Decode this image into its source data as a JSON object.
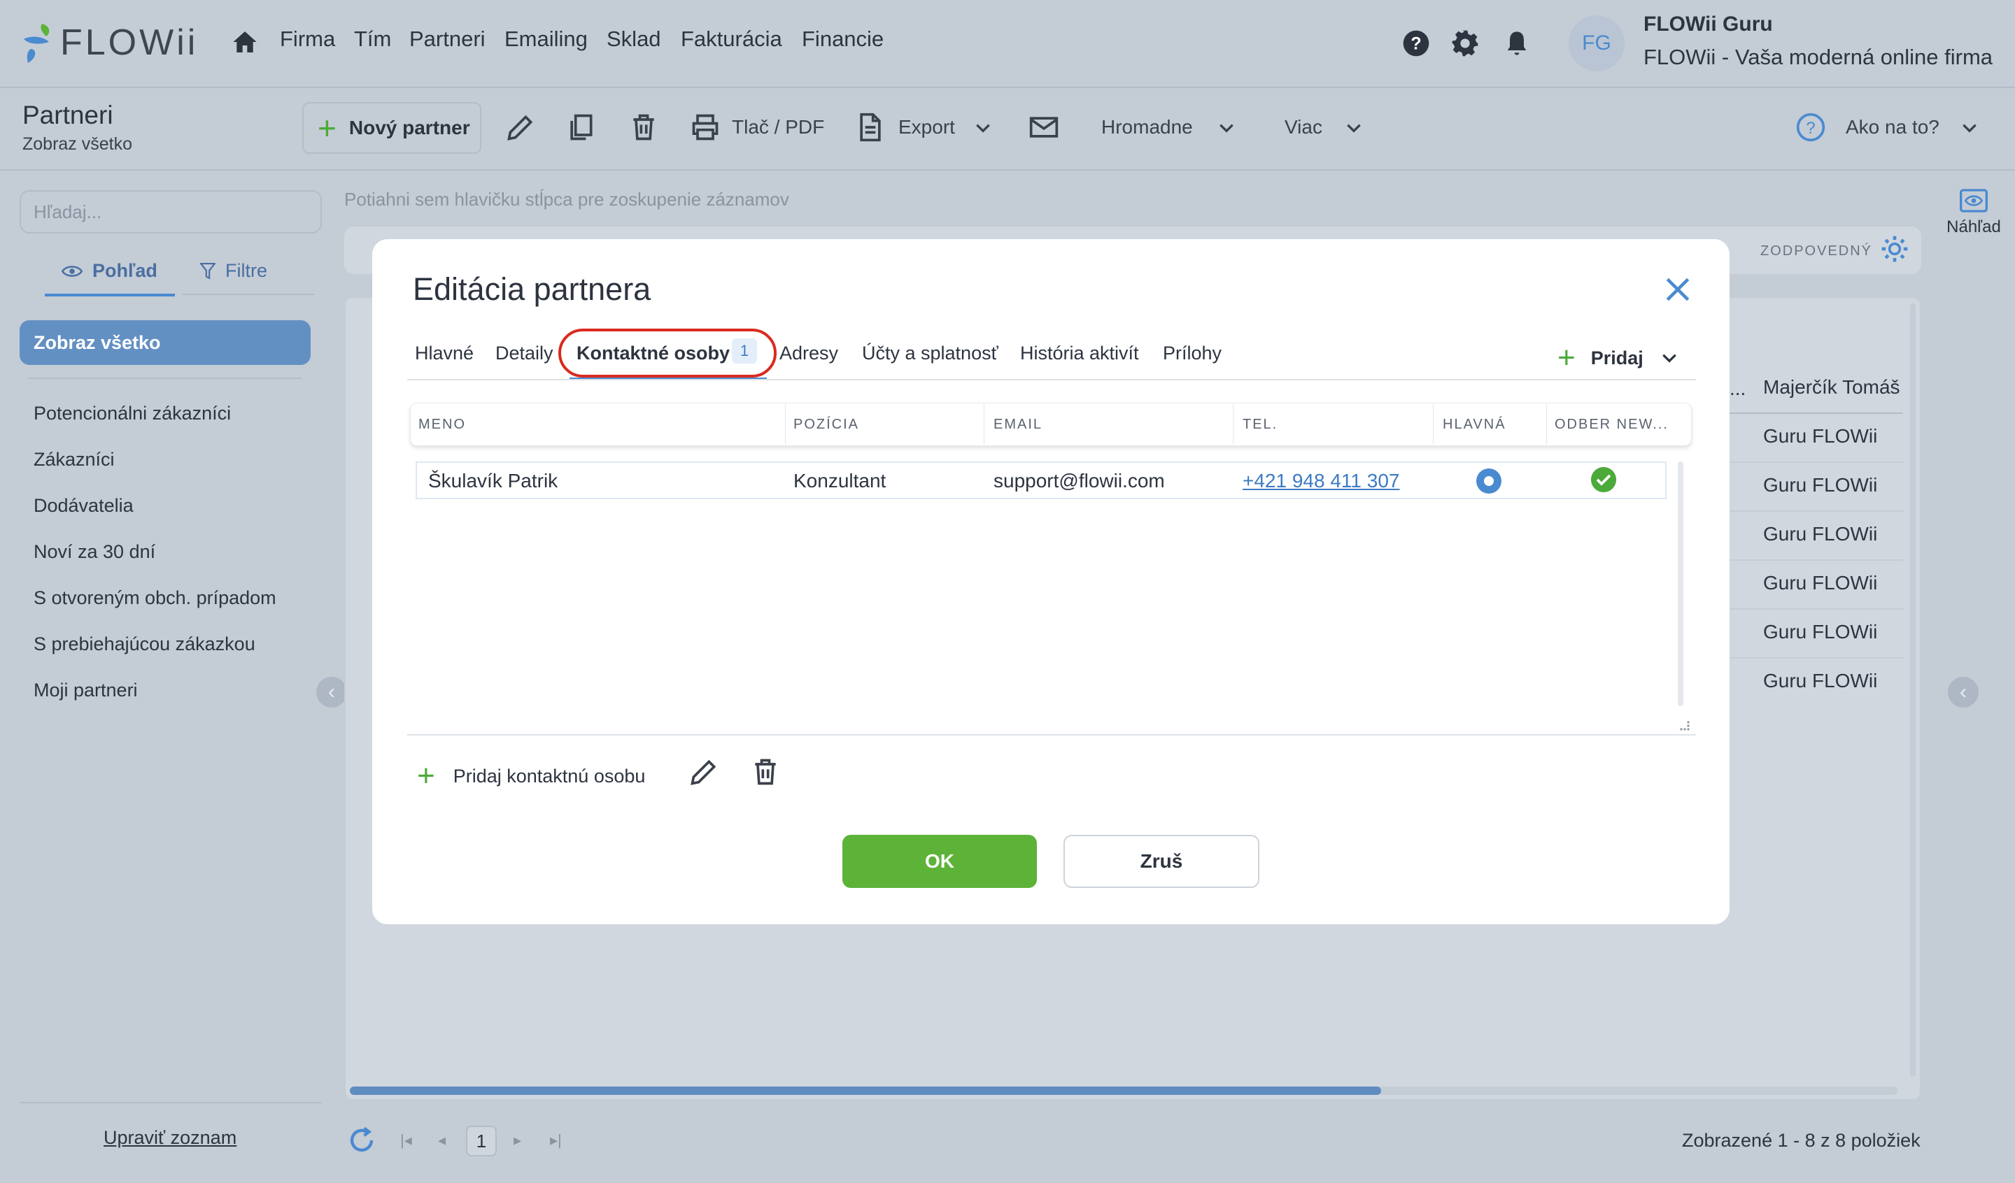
{
  "app": {
    "logo_text": "FLOWii"
  },
  "nav": {
    "items": [
      "Firma",
      "Tím",
      "Partneri",
      "Emailing",
      "Sklad",
      "Fakturácia",
      "Financie"
    ]
  },
  "user": {
    "initials": "FG",
    "name": "FLOWii Guru",
    "company": "FLOWii - Vaša moderná online firma"
  },
  "toolbar": {
    "title": "Partneri",
    "subtitle": "Zobraz všetko",
    "new_partner": "Nový partner",
    "print": "Tlač / PDF",
    "export": "Export",
    "bulk": "Hromadne",
    "more": "Viac",
    "help": "Ako na to?"
  },
  "sidebar": {
    "search_placeholder": "Hľadaj...",
    "tab_view": "Pohľad",
    "tab_filter": "Filtre",
    "active_item": "Zobraz všetko",
    "items": [
      "Potencionálni zákazníci",
      "Zákazníci",
      "Dodávatelia",
      "Noví za 30 dní",
      "S otvoreným obch. prípadom",
      "S prebiehajúcou zákazkou",
      "Moji partneri"
    ],
    "edit_list": "Upraviť zoznam"
  },
  "main": {
    "group_hint": "Potiahni sem hlavičku stĺpca pre zoskupenie záznamov",
    "responsible_label": "ZODPOVEDNÝ",
    "preview_label": "Náhľad",
    "col_ellipsis": "...",
    "visible_rows": [
      "Majerčík Tomáš",
      "Guru FLOWii",
      "Guru FLOWii",
      "Guru FLOWii",
      "Guru FLOWii",
      "Guru FLOWii",
      "Guru FLOWii"
    ]
  },
  "pager": {
    "page": "1",
    "info": "Zobrazené 1 - 8 z 8 položiek"
  },
  "modal": {
    "title": "Editácia partnera",
    "tabs": [
      "Hlavné",
      "Detaily",
      "Kontaktné osoby",
      "Adresy",
      "Účty a splatnosť",
      "História aktivít",
      "Prílohy"
    ],
    "active_tab_badge": "1",
    "add_label": "Pridaj",
    "columns": [
      "MENO",
      "POZÍCIA",
      "EMAIL",
      "TEL.",
      "HLAVNÁ",
      "ODBER NEW..."
    ],
    "contacts": [
      {
        "name": "Škulavík Patrik",
        "position": "Konzultant",
        "email": "support@flowii.com",
        "phone": "+421 948 411 307",
        "main": true,
        "newsletter": true
      }
    ],
    "add_contact": "Pridaj kontaktnú osobu",
    "ok": "OK",
    "cancel": "Zruš"
  },
  "colors": {
    "accent_blue": "#4a8ad0",
    "green": "#5cb338",
    "highlight_red": "#d92b1e"
  }
}
